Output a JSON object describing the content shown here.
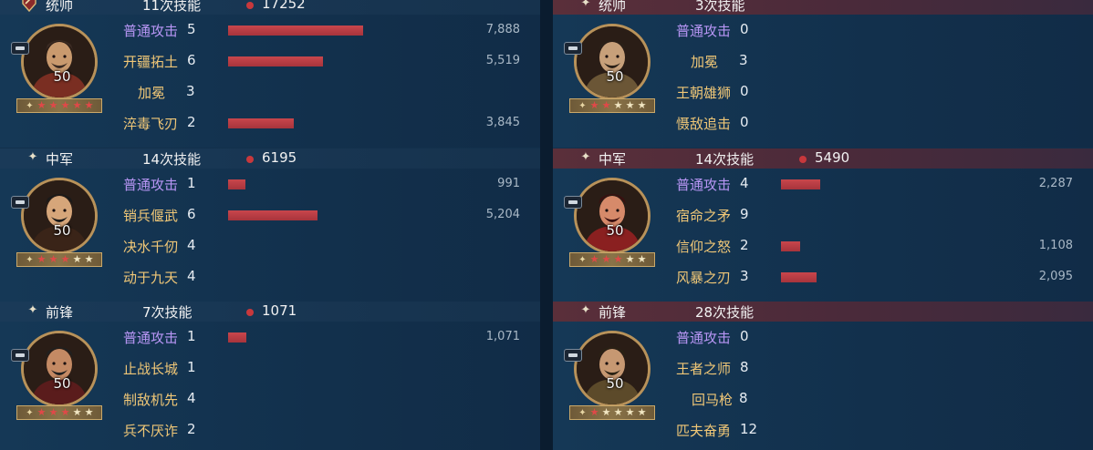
{
  "panels": [
    {
      "side": "left",
      "sections": [
        {
          "role": "统帅",
          "skills_label": "11次技能",
          "total": "17252",
          "level": "50",
          "red_stars": 5,
          "rows": [
            {
              "name": "普通攻击",
              "count": "5",
              "damage": "7,888",
              "normal": true,
              "bar": 7888
            },
            {
              "name": "开疆拓土",
              "count": "6",
              "damage": "5,519",
              "normal": false,
              "bar": 5519
            },
            {
              "name": "加冕",
              "count": "3",
              "damage": "",
              "normal": false,
              "bar": 0,
              "indent": true
            },
            {
              "name": "淬毒飞刃",
              "count": "2",
              "damage": "3,845",
              "normal": false,
              "bar": 3845
            }
          ]
        },
        {
          "role": "中军",
          "skills_label": "14次技能",
          "total": "6195",
          "level": "50",
          "red_stars": 3,
          "rows": [
            {
              "name": "普通攻击",
              "count": "1",
              "damage": "991",
              "normal": true,
              "bar": 991
            },
            {
              "name": "销兵偃武",
              "count": "6",
              "damage": "5,204",
              "normal": false,
              "bar": 5204
            },
            {
              "name": "决水千仞",
              "count": "4",
              "damage": "",
              "normal": false,
              "bar": 0
            },
            {
              "name": "动于九天",
              "count": "4",
              "damage": "",
              "normal": false,
              "bar": 0
            }
          ]
        },
        {
          "role": "前锋",
          "skills_label": "7次技能",
          "total": "1071",
          "level": "50",
          "red_stars": 3,
          "rows": [
            {
              "name": "普通攻击",
              "count": "1",
              "damage": "1,071",
              "normal": true,
              "bar": 1071
            },
            {
              "name": "止战长城",
              "count": "1",
              "damage": "",
              "normal": false,
              "bar": 0
            },
            {
              "name": "制敌机先",
              "count": "4",
              "damage": "",
              "normal": false,
              "bar": 0
            },
            {
              "name": "兵不厌诈",
              "count": "2",
              "damage": "",
              "normal": false,
              "bar": 0
            }
          ]
        }
      ]
    },
    {
      "side": "right",
      "sections": [
        {
          "role": "统帅",
          "skills_label": "3次技能",
          "total": "",
          "level": "50",
          "red_stars": 2,
          "rows": [
            {
              "name": "普通攻击",
              "count": "0",
              "damage": "",
              "normal": true,
              "bar": 0
            },
            {
              "name": "加冕",
              "count": "3",
              "damage": "",
              "normal": false,
              "bar": 0,
              "indent": true
            },
            {
              "name": "王朝雄狮",
              "count": "0",
              "damage": "",
              "normal": false,
              "bar": 0
            },
            {
              "name": "慑敌追击",
              "count": "0",
              "damage": "",
              "normal": false,
              "bar": 0
            }
          ]
        },
        {
          "role": "中军",
          "skills_label": "14次技能",
          "total": "5490",
          "level": "50",
          "red_stars": 3,
          "rows": [
            {
              "name": "普通攻击",
              "count": "4",
              "damage": "2,287",
              "normal": true,
              "bar": 2287
            },
            {
              "name": "宿命之矛",
              "count": "9",
              "damage": "",
              "normal": false,
              "bar": 0
            },
            {
              "name": "信仰之怒",
              "count": "2",
              "damage": "1,108",
              "normal": false,
              "bar": 1108
            },
            {
              "name": "风暴之刃",
              "count": "3",
              "damage": "2,095",
              "normal": false,
              "bar": 2095
            }
          ]
        },
        {
          "role": "前锋",
          "skills_label": "28次技能",
          "total": "",
          "level": "50",
          "red_stars": 1,
          "rows": [
            {
              "name": "普通攻击",
              "count": "0",
              "damage": "",
              "normal": true,
              "bar": 0
            },
            {
              "name": "王者之师",
              "count": "8",
              "damage": "",
              "normal": false,
              "bar": 0
            },
            {
              "name": "回马枪",
              "count": "8",
              "damage": "",
              "normal": false,
              "bar": 0,
              "indent": true
            },
            {
              "name": "匹夫奋勇",
              "count": "12",
              "damage": "",
              "normal": false,
              "bar": 0
            }
          ]
        }
      ]
    }
  ],
  "colors": {
    "bar": "#b83c44",
    "normal_skill": "#b896f5",
    "skill": "#f0c777",
    "dot": "#c8383c"
  }
}
